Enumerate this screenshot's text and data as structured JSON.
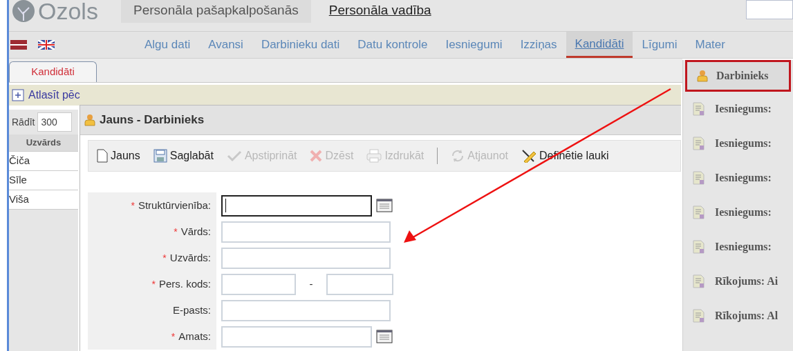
{
  "header": {
    "logo": "Ozols",
    "modules": [
      {
        "label": "Personāla pašapkalpošanās",
        "selected": false
      },
      {
        "label": "Personāla vadība",
        "selected": true
      }
    ]
  },
  "nav": [
    {
      "label": "Algu dati",
      "selected": false
    },
    {
      "label": "Avansi",
      "selected": false
    },
    {
      "label": "Darbinieku dati",
      "selected": false
    },
    {
      "label": "Datu kontrole",
      "selected": false
    },
    {
      "label": "Iesniegumi",
      "selected": false
    },
    {
      "label": "Izziņas",
      "selected": false
    },
    {
      "label": "Kandidāti",
      "selected": true
    },
    {
      "label": "Līgumi",
      "selected": false
    },
    {
      "label": "Mater",
      "selected": false
    }
  ],
  "tabs": [
    {
      "label": "Kandidāti",
      "selected": true
    }
  ],
  "filter": {
    "label": "Atlasīt pēc"
  },
  "show": {
    "label": "Rādīt",
    "value": "300"
  },
  "list": {
    "column": "Uzvārds",
    "rows": [
      "Čiča",
      "Sīle",
      "Viša"
    ]
  },
  "dialog": {
    "title": "Jauns - Darbinieks",
    "required_mark": "*",
    "toolbar": [
      {
        "kind": "new",
        "label": "Jauns",
        "disabled": false
      },
      {
        "kind": "save",
        "label": "Saglabāt",
        "disabled": false
      },
      {
        "kind": "approve",
        "label": "Apstiprināt",
        "disabled": true
      },
      {
        "kind": "delete",
        "label": "Dzēst",
        "disabled": true
      },
      {
        "kind": "print",
        "label": "Izdrukāt",
        "disabled": true
      },
      {
        "kind": "separator"
      },
      {
        "kind": "refresh",
        "label": "Atjaunot",
        "disabled": true
      },
      {
        "kind": "fields",
        "label": "Definētie lauki",
        "disabled": false
      }
    ],
    "fields": [
      {
        "kind": "lookup",
        "label": "Struktūrvienība:",
        "required": true,
        "focused": true
      },
      {
        "kind": "text",
        "label": "Vārds:",
        "required": true,
        "focused": false
      },
      {
        "kind": "text",
        "label": "Uzvārds:",
        "required": true,
        "focused": false
      },
      {
        "kind": "split",
        "label": "Pers. kods:",
        "required": true,
        "focused": false,
        "separator": "-"
      },
      {
        "kind": "text",
        "label": "E-pasts:",
        "required": false,
        "focused": false
      },
      {
        "kind": "lookup",
        "label": "Amats:",
        "required": true,
        "focused": false
      }
    ]
  },
  "menu": [
    {
      "kind": "person",
      "label": "Darbinieks",
      "highlighted": true
    },
    {
      "kind": "document",
      "label": "Iesniegums:",
      "highlighted": false
    },
    {
      "kind": "document",
      "label": "Iesniegums:",
      "highlighted": false
    },
    {
      "kind": "document",
      "label": "Iesniegums:",
      "highlighted": false
    },
    {
      "kind": "document",
      "label": "Iesniegums:",
      "highlighted": false
    },
    {
      "kind": "document",
      "label": "Iesniegums:",
      "highlighted": false
    },
    {
      "kind": "document",
      "label": "Rīkojums: Ai",
      "highlighted": false
    },
    {
      "kind": "document",
      "label": "Rīkojums: Al",
      "highlighted": false
    }
  ]
}
